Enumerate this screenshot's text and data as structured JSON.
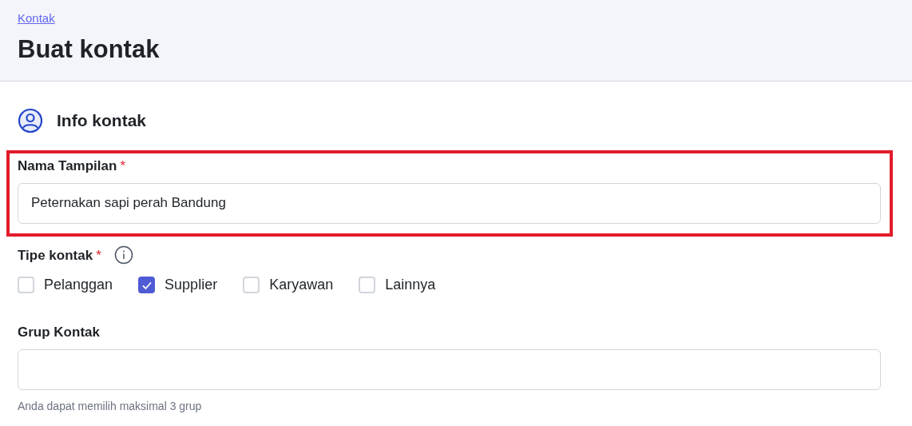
{
  "breadcrumb": {
    "label": "Kontak"
  },
  "page_title": "Buat kontak",
  "section": {
    "title": "Info kontak"
  },
  "fields": [
    {
      "kind": "text",
      "label": "Nama Tampilan",
      "required_mark": "*",
      "value": "Peternakan sapi perah Bandung",
      "highlighted": true
    },
    {
      "kind": "checkboxes",
      "label": "Tipe kontak",
      "required_mark": "*",
      "info": true,
      "options": [
        {
          "label": "Pelanggan",
          "checked": false
        },
        {
          "label": "Supplier",
          "checked": true
        },
        {
          "label": "Karyawan",
          "checked": false
        },
        {
          "label": "Lainnya",
          "checked": false
        }
      ]
    },
    {
      "kind": "text",
      "label": "Grup Kontak",
      "hint": "Anda dapat memilih maksimal 3 grup",
      "highlighted": false
    }
  ]
}
